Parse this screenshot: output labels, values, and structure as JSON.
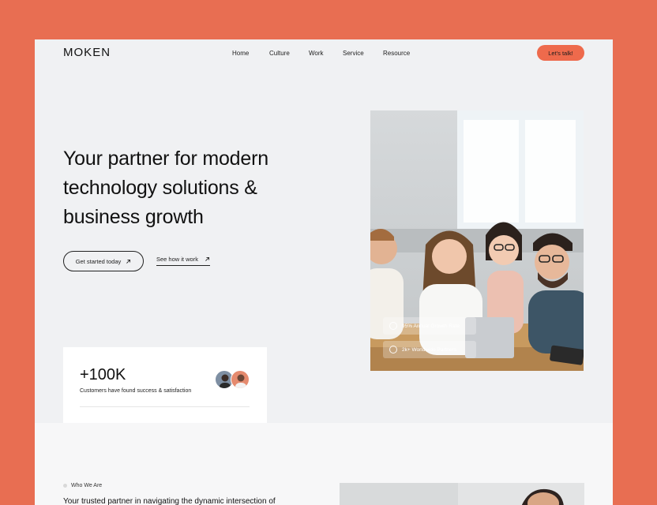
{
  "nav": {
    "logo": "MOKEN",
    "logo_parts": [
      "MO",
      "K",
      "EN"
    ],
    "links": [
      "Home",
      "Culture",
      "Work",
      "Service",
      "Resource"
    ],
    "cta": "Let's talk!"
  },
  "hero": {
    "headline_lines": [
      "Your partner for modern",
      "technology solutions &",
      "business growth"
    ],
    "primary_button": "Get started today",
    "secondary_link": "See how it work"
  },
  "stat": {
    "value": "+100K",
    "caption": "Customers have found success & satisfaction"
  },
  "photo": {
    "badges": [
      "95% Annual Growth Rate",
      "2k+ Worldwide Partners"
    ]
  },
  "about": {
    "tag": "Who We Are",
    "heading": "Your trusted partner in navigating the dynamic intersection of"
  },
  "colors": {
    "background": "#E86E52",
    "accent": "#EE6A4C",
    "page": "#F0F1F3"
  },
  "icons": [
    "arrow-up-right-icon",
    "growth-icon",
    "globe-icon"
  ]
}
